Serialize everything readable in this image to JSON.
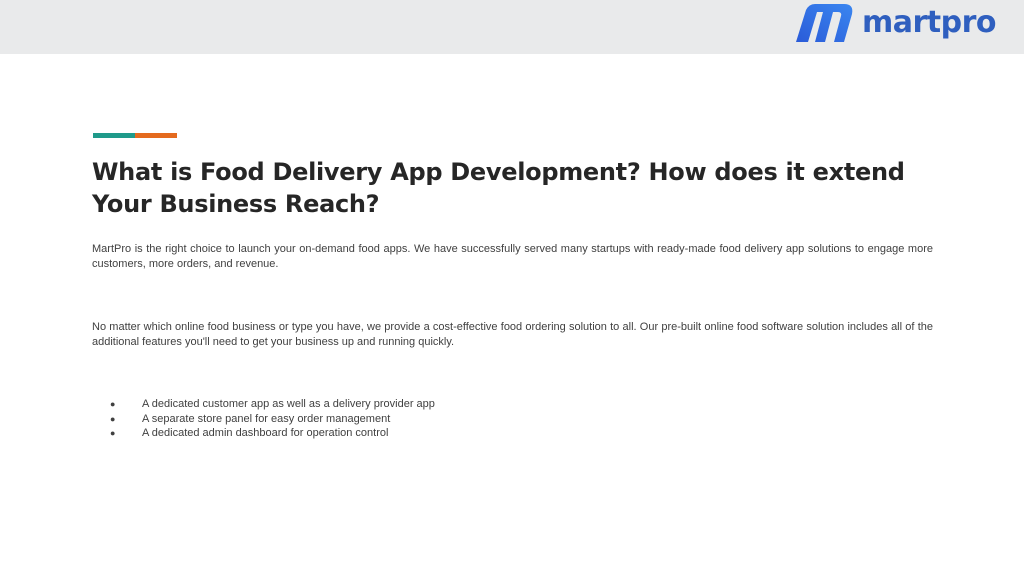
{
  "header": {
    "logo_text": "martpro",
    "logo_color": "#2f5fbf",
    "logo_mark_color": "#2f6fe0"
  },
  "accent": {
    "left_color": "#1f9a8a",
    "right_color": "#e46a1e"
  },
  "title": "What is Food Delivery App Development? How does it extend Your Business Reach?",
  "paragraphs": [
    "MartPro is the right choice to launch your on-demand food apps. We have successfully served many startups with ready-made food delivery app solutions to engage more customers, more orders, and revenue.",
    "No matter which online food business or type you have, we provide a cost-effective food ordering solution to all. Our pre-built online food software solution includes all of the additional features you'll need to get your business up and running quickly."
  ],
  "bullets": [
    "A dedicated customer app as well as a delivery provider app",
    "A separate store panel for easy order management",
    "A dedicated admin dashboard for operation control"
  ]
}
